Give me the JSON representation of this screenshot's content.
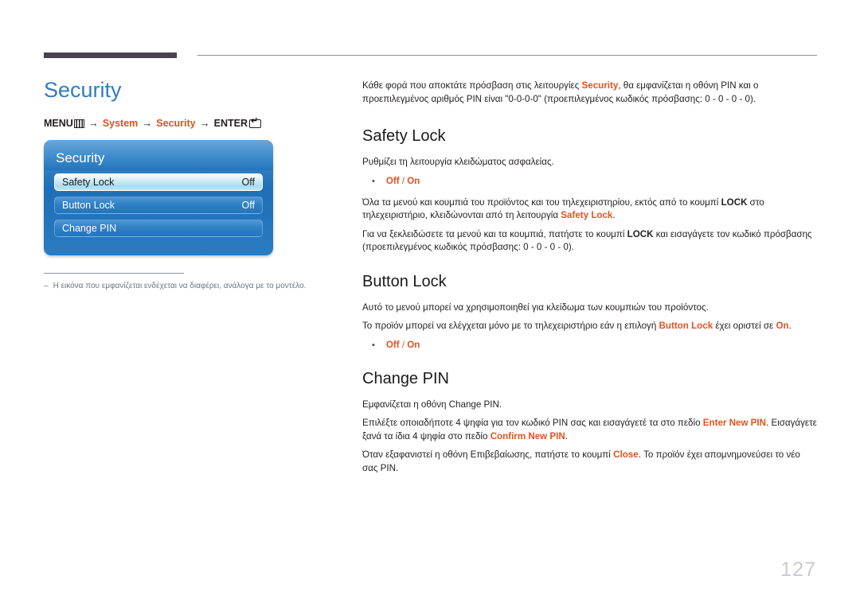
{
  "page": {
    "title": "Security",
    "number": "127"
  },
  "breadcrumb": {
    "menu_label": "MENU",
    "menu_icon": "menu-bars-icon",
    "arrow": "→",
    "item1": "System",
    "item2": "Security",
    "enter_label": "ENTER",
    "enter_icon": "enter-key-icon"
  },
  "osd": {
    "title": "Security",
    "rows": [
      {
        "label": "Safety Lock",
        "value": "Off",
        "selected": true
      },
      {
        "label": "Button Lock",
        "value": "Off",
        "selected": false
      },
      {
        "label": "Change PIN",
        "value": "",
        "selected": false
      }
    ]
  },
  "footnote": {
    "dash": "–",
    "text": "Η εικόνα που εμφανίζεται ενδέχεται να διαφέρει, ανάλογα με το μοντέλο."
  },
  "intro": {
    "part1": "Κάθε φορά που αποκτάτε πρόσβαση στις λειτουργίες ",
    "highlight": "Security",
    "part2": ", θα εμφανίζεται η οθόνη PIN και ο προεπιλεγμένος αριθμός PIN είναι \"0-0-0-0\" (προεπιλεγμένος κωδικός πρόσβασης: 0 - 0 - 0 - 0)."
  },
  "sections": [
    {
      "heading": "Safety Lock",
      "p1": "Ρυθμίζει τη λειτουργία κλειδώματος ασφαλείας.",
      "bullet_off": "Off",
      "bullet_sep": " / ",
      "bullet_on": "On",
      "p2_a": "Όλα τα μενού και κουμπιά του προϊόντος και του τηλεχειριστηρίου, εκτός από το κουμπί ",
      "p2_lock": "LOCK",
      "p2_b": " στο τηλεχειριστήριο, κλειδώνονται από τη λειτουργία ",
      "p2_highlight": "Safety Lock",
      "p2_c": ".",
      "p3_a": "Για να ξεκλειδώσετε τα μενού και τα κουμπιά, πατήστε το κουμπί ",
      "p3_lock": "LOCK",
      "p3_b": " και εισαγάγετε τον κωδικό πρόσβασης (προεπιλεγμένος κωδικός πρόσβασης: 0 - 0 - 0 - 0)."
    },
    {
      "heading": "Button Lock",
      "p1": "Αυτό το μενού μπορεί να χρησιμοποιηθεί για κλείδωμα των κουμπιών του προϊόντος.",
      "p2_a": "Το προϊόν μπορεί να ελέγχεται μόνο με το τηλεχειριστήριο εάν η επιλογή ",
      "p2_highlight": "Button Lock",
      "p2_b": " έχει οριστεί σε ",
      "p2_on": "On",
      "p2_c": ".",
      "bullet_off": "Off",
      "bullet_sep": " / ",
      "bullet_on": "On"
    },
    {
      "heading": "Change PIN",
      "p1": "Εμφανίζεται η οθόνη Change PIN.",
      "p2_a": "Επιλέξτε οποιαδήποτε 4 ψηφία για τον κωδικό PIN σας και εισαγάγετέ τα στο πεδίο ",
      "p2_enter": "Enter New PIN",
      "p2_b": ". Εισαγάγετε ξανά τα ίδια 4 ψηφία στο πεδίο ",
      "p2_confirm": "Confirm New PIN",
      "p2_c": ".",
      "p3_a": "Όταν εξαφανιστεί η οθόνη Επιβεβαίωσης, πατήστε το κουμπί ",
      "p3_close": "Close",
      "p3_b": ". Το προϊόν έχει απομνημονεύσει το νέο σας PIN."
    }
  ]
}
